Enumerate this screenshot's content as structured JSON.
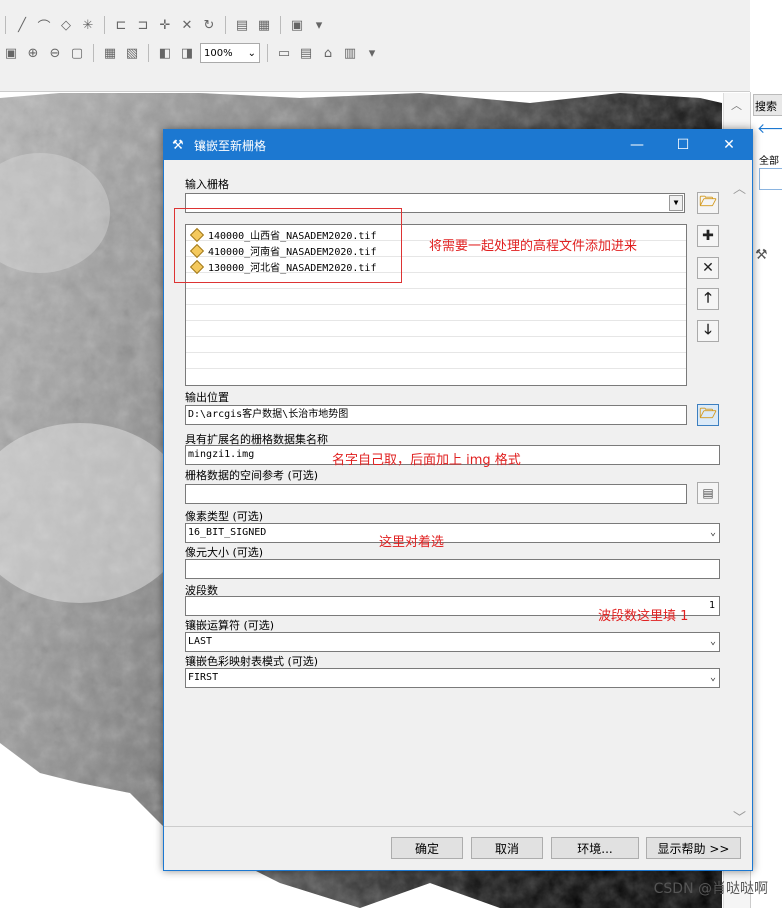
{
  "toolbar": {
    "zoom": "100%"
  },
  "sidepanel": {
    "search_tab": "搜索",
    "all_label": "全部"
  },
  "dialog": {
    "title": "镶嵌至新栅格",
    "input_label": "输入栅格",
    "input_value": "",
    "rasters": [
      "140000_山西省_NASADEM2020.tif",
      "410000_河南省_NASADEM2020.tif",
      "130000_河北省_NASADEM2020.tif"
    ],
    "output_label": "输出位置",
    "output_value": "D:\\arcgis客户数据\\长治市地势图",
    "name_label": "具有扩展名的栅格数据集名称",
    "name_value": "mingzi1.img",
    "sr_label": "栅格数据的空间参考 (可选)",
    "sr_value": "",
    "pixel_label": "像素类型 (可选)",
    "pixel_value": "16_BIT_SIGNED",
    "cell_label": "像元大小 (可选)",
    "cell_value": "",
    "bands_label": "波段数",
    "bands_value": "1",
    "mosaic_label": "镶嵌运算符 (可选)",
    "mosaic_value": "LAST",
    "colormap_label": "镶嵌色彩映射表模式 (可选)",
    "colormap_value": "FIRST",
    "buttons": {
      "ok": "确定",
      "cancel": "取消",
      "env": "环境...",
      "help": "显示帮助 >>"
    }
  },
  "annotations": {
    "add_files": "将需要一起处理的高程文件添加进来",
    "name_hint": "名字自己取，后面加上 img 格式",
    "pixel_hint": "这里对着选",
    "band_hint": "波段数这里填 1"
  },
  "watermark": "CSDN @肖哒哒啊",
  "colors": {
    "title_bar": "#1c78d1",
    "annotation": "#e02020"
  }
}
